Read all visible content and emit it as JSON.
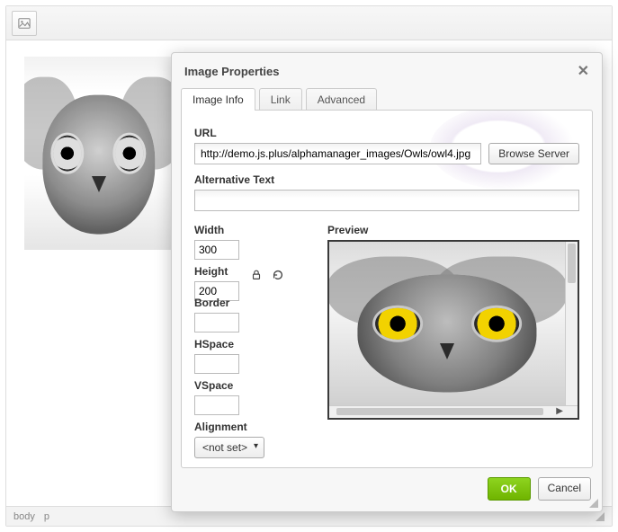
{
  "toolbar": {
    "image_btn_title": "Image"
  },
  "status": {
    "path1": "body",
    "path2": "p"
  },
  "dialog": {
    "title": "Image  Properties",
    "tabs": {
      "info": "Image  Info",
      "link": "Link",
      "advanced": "Advanced"
    },
    "labels": {
      "url": "URL",
      "alt": "Alternative  Text",
      "width": "Width",
      "height": "Height",
      "border": "Border",
      "hspace": "HSpace",
      "vspace": "VSpace",
      "alignment": "Alignment",
      "preview": "Preview"
    },
    "values": {
      "url": "http://demo.js.plus/alphamanager_images/Owls/owl4.jpg",
      "alt": "",
      "width": "300",
      "height": "200",
      "border": "",
      "hspace": "",
      "vspace": "",
      "alignment": "<not set>"
    },
    "buttons": {
      "browse": "Browse  Server",
      "ok": "OK",
      "cancel": "Cancel"
    }
  }
}
